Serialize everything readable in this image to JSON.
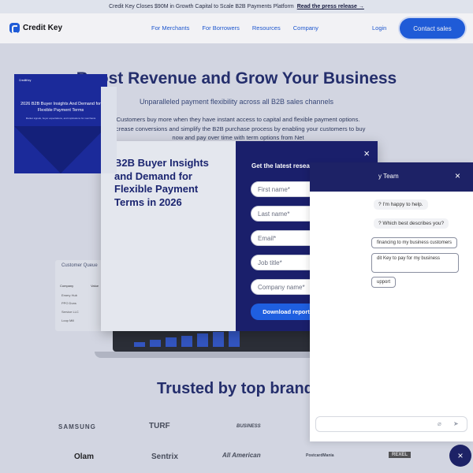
{
  "announcement": {
    "text": "Credit Key Closes $90M in Growth Capital to Scale B2B Payments Platform",
    "link": "Read the press release →"
  },
  "nav": {
    "brand": "Credit Key",
    "links": [
      "For Merchants",
      "For Borrowers",
      "Resources",
      "Company"
    ],
    "login": "Login",
    "cta": "Contact sales"
  },
  "hero": {
    "title": "Boost Revenue and Grow Your Business",
    "subtitle": "Unparalleled payment flexibility across all B2B sales channels",
    "body": "Customers buy more when they have instant access to capital and flexible payment options. Increase conversions and simplify the B2B purchase process by enabling your customers to buy now and pay over time with term options from Net"
  },
  "dashboard": {
    "queue_title": "Customer Queue",
    "columns": [
      "Company",
      "Value"
    ],
    "rows": [
      "Emery Hub",
      "PPO Duns",
      "Service LLC",
      "Loop Mill"
    ]
  },
  "trusted": {
    "title": "Trusted by top brand"
  },
  "brands": [
    "SAMSUNG",
    "TURF",
    "BUSINESS",
    "Olam",
    "Sentrix",
    "All American",
    "PostcardMania",
    "REXEL"
  ],
  "modal": {
    "headline": "B2B Buyer Insights and Demand for Flexible Payment Terms in 2026",
    "book_logo": "CreditKey",
    "book_title": "2026 B2B Buyer Insights And Demand for Flexible Payment Terms",
    "book_sub": "Market signals, buyer expectations, and implications for merchants",
    "form_title": "Get the latest research and strategies",
    "fields": [
      "First name*",
      "Last name*",
      "Email*",
      "Job title*",
      "Company name*"
    ],
    "submit": "Download report",
    "close_icon": "×"
  },
  "chat": {
    "team": "y Team",
    "messages": [
      "? I'm happy to help.",
      "? Which best describes you?"
    ],
    "options": [
      "financing to my business customers",
      "dit Key to pay for my business",
      "upport"
    ],
    "close_icon": "×"
  }
}
